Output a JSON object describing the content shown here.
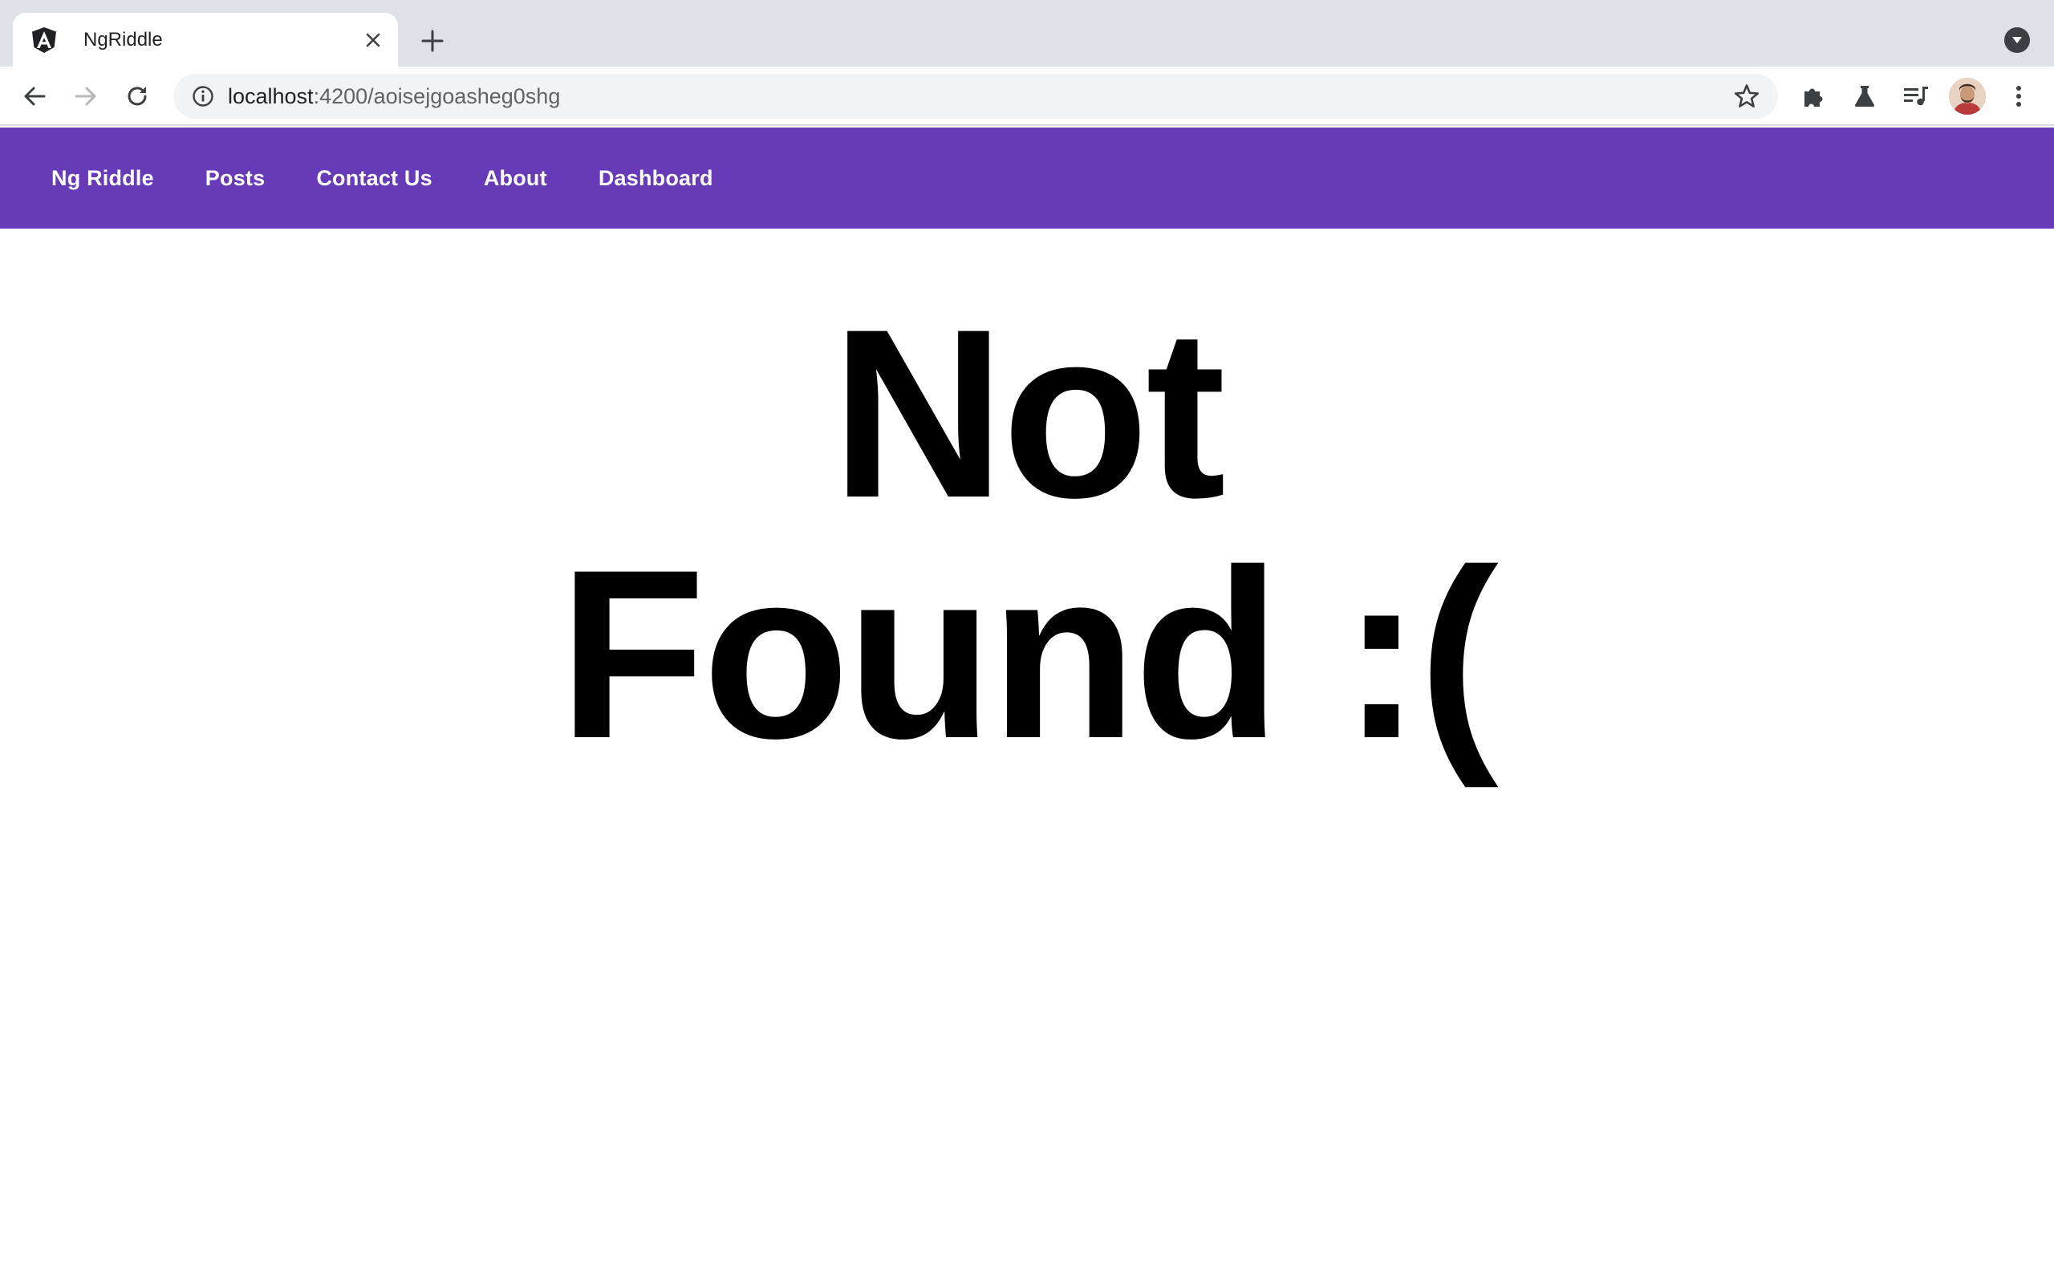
{
  "browser": {
    "tab_title": "NgRiddle",
    "url_host": "localhost",
    "url_rest": ":4200/aoisejgoasheg0shg",
    "favicon": "angular-logo",
    "icons": [
      "back-arrow-icon",
      "forward-arrow-icon",
      "reload-icon",
      "info-icon",
      "star-icon",
      "puzzle-icon",
      "flask-icon",
      "playlist-icon",
      "kebab-menu-icon"
    ]
  },
  "nav": {
    "brand": "Ng Riddle",
    "links": [
      "Posts",
      "Contact Us",
      "About",
      "Dashboard"
    ],
    "color": "#673ab7"
  },
  "main": {
    "line1": "Not",
    "line2": "Found :("
  }
}
